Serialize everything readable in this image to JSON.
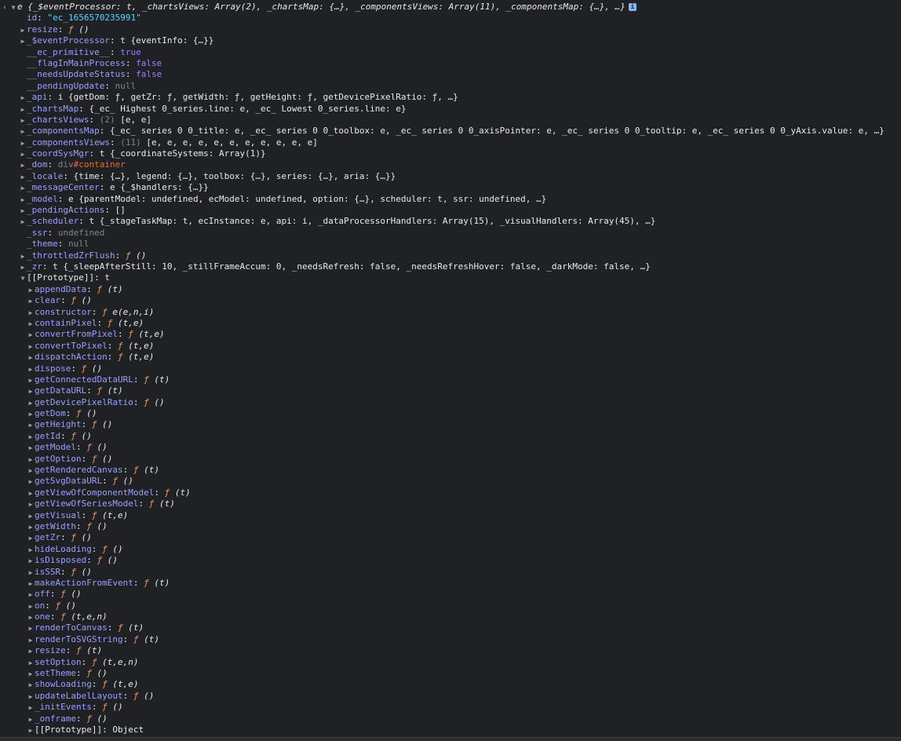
{
  "header": {
    "back_icon": "chevron-left-icon",
    "name": "e",
    "summary": "{_$eventProcessor: t, _chartsViews: Array(2), _chartsMap: {…}, _componentsViews: Array(11), _componentsMap: {…}, …}",
    "info_label": "i"
  },
  "rows": [
    {
      "indent": 1,
      "expand": false,
      "key": "id",
      "parts": [
        {
          "c": "v-str",
          "t": "\"ec_1656570235991\""
        }
      ]
    },
    {
      "indent": 1,
      "expand": true,
      "key": "resize",
      "parts": [
        {
          "c": "f-kw",
          "t": "ƒ "
        },
        {
          "c": "f-args",
          "t": "()"
        }
      ]
    },
    {
      "indent": 1,
      "expand": true,
      "key": "_$eventProcessor",
      "parts": [
        {
          "c": "v-obj",
          "t": "t {eventInfo: {…}}"
        }
      ]
    },
    {
      "indent": 1,
      "expand": false,
      "key": "__ec_primitive__",
      "parts": [
        {
          "c": "v-bool",
          "t": "true"
        }
      ]
    },
    {
      "indent": 1,
      "expand": false,
      "key": "__flagInMainProcess",
      "parts": [
        {
          "c": "v-bool",
          "t": "false"
        }
      ]
    },
    {
      "indent": 1,
      "expand": false,
      "key": "__needsUpdateStatus",
      "parts": [
        {
          "c": "v-bool",
          "t": "false"
        }
      ]
    },
    {
      "indent": 1,
      "expand": false,
      "key": "__pendingUpdate",
      "parts": [
        {
          "c": "v-null",
          "t": "null"
        }
      ]
    },
    {
      "indent": 1,
      "expand": true,
      "key": "_api",
      "parts": [
        {
          "c": "v-obj",
          "t": "i {getDom: ƒ, getZr: ƒ, getWidth: ƒ, getHeight: ƒ, getDevicePixelRatio: ƒ, …}"
        }
      ]
    },
    {
      "indent": 1,
      "expand": true,
      "key": "_chartsMap",
      "parts": [
        {
          "c": "v-obj",
          "t": "{_ec_ Highest 0_series.line: e, _ec_ Lowest 0_series.line: e}"
        }
      ]
    },
    {
      "indent": 1,
      "expand": true,
      "key": "_chartsViews",
      "parts": [
        {
          "c": "v-null",
          "t": "(2) "
        },
        {
          "c": "v-obj",
          "t": "[e, e]"
        }
      ]
    },
    {
      "indent": 1,
      "expand": true,
      "key": "_componentsMap",
      "parts": [
        {
          "c": "v-obj",
          "t": "{_ec_ series 0 0_title: e, _ec_ series 0 0_toolbox: e, _ec_ series 0 0_axisPointer: e, _ec_ series 0 0_tooltip: e, _ec_ series 0 0_yAxis.value: e, …}"
        }
      ]
    },
    {
      "indent": 1,
      "expand": true,
      "key": "_componentsViews",
      "parts": [
        {
          "c": "v-null",
          "t": "(11) "
        },
        {
          "c": "v-obj",
          "t": "[e, e, e, e, e, e, e, e, e, e, e]"
        }
      ]
    },
    {
      "indent": 1,
      "expand": true,
      "key": "_coordSysMgr",
      "parts": [
        {
          "c": "v-obj",
          "t": "t {_coordinateSystems: Array(1)}"
        }
      ]
    },
    {
      "indent": 1,
      "expand": true,
      "key": "_dom",
      "parts": [
        {
          "c": "v-null",
          "t": "div"
        },
        {
          "c": "v-tag",
          "t": "#container"
        }
      ]
    },
    {
      "indent": 1,
      "expand": true,
      "key": "_locale",
      "parts": [
        {
          "c": "v-obj",
          "t": "{time: {…}, legend: {…}, toolbox: {…}, series: {…}, aria: {…}}"
        }
      ]
    },
    {
      "indent": 1,
      "expand": true,
      "key": "_messageCenter",
      "parts": [
        {
          "c": "v-obj",
          "t": "e {_$handlers: {…}}"
        }
      ]
    },
    {
      "indent": 1,
      "expand": true,
      "key": "_model",
      "parts": [
        {
          "c": "v-obj",
          "t": "e {parentModel: undefined, ecModel: undefined, option: {…}, scheduler: t, ssr: undefined, …}"
        }
      ]
    },
    {
      "indent": 1,
      "expand": true,
      "key": "_pendingActions",
      "parts": [
        {
          "c": "v-obj",
          "t": "[]"
        }
      ]
    },
    {
      "indent": 1,
      "expand": true,
      "key": "_scheduler",
      "parts": [
        {
          "c": "v-obj",
          "t": "t {_stageTaskMap: t, ecInstance: e, api: i, _dataProcessorHandlers: Array(15), _visualHandlers: Array(45), …}"
        }
      ]
    },
    {
      "indent": 1,
      "expand": false,
      "key": "_ssr",
      "parts": [
        {
          "c": "v-null",
          "t": "undefined"
        }
      ]
    },
    {
      "indent": 1,
      "expand": false,
      "key": "_theme",
      "parts": [
        {
          "c": "v-null",
          "t": "null"
        }
      ]
    },
    {
      "indent": 1,
      "expand": true,
      "key": "_throttledZrFlush",
      "parts": [
        {
          "c": "f-kw",
          "t": "ƒ "
        },
        {
          "c": "f-args",
          "t": "()"
        }
      ]
    },
    {
      "indent": 1,
      "expand": true,
      "key": "_zr",
      "parts": [
        {
          "c": "v-obj",
          "t": "t {_sleepAfterStill: 10, _stillFrameAccum: 0, _needsRefresh: false, _needsRefreshHover: false, _darkMode: false, …}"
        }
      ]
    },
    {
      "indent": 1,
      "expand": "open",
      "key": "[[Prototype]]",
      "plainkey": true,
      "parts": [
        {
          "c": "v-obj",
          "t": "t"
        }
      ]
    },
    {
      "indent": 2,
      "expand": true,
      "key": "appendData",
      "parts": [
        {
          "c": "f-kw",
          "t": "ƒ "
        },
        {
          "c": "f-args",
          "t": "(t)"
        }
      ]
    },
    {
      "indent": 2,
      "expand": true,
      "key": "clear",
      "parts": [
        {
          "c": "f-kw",
          "t": "ƒ "
        },
        {
          "c": "f-args",
          "t": "()"
        }
      ]
    },
    {
      "indent": 2,
      "expand": true,
      "key": "constructor",
      "parts": [
        {
          "c": "f-kw",
          "t": "ƒ "
        },
        {
          "c": "f-args",
          "t": "e(e,n,i)"
        }
      ]
    },
    {
      "indent": 2,
      "expand": true,
      "key": "containPixel",
      "parts": [
        {
          "c": "f-kw",
          "t": "ƒ "
        },
        {
          "c": "f-args",
          "t": "(t,e)"
        }
      ]
    },
    {
      "indent": 2,
      "expand": true,
      "key": "convertFromPixel",
      "parts": [
        {
          "c": "f-kw",
          "t": "ƒ "
        },
        {
          "c": "f-args",
          "t": "(t,e)"
        }
      ]
    },
    {
      "indent": 2,
      "expand": true,
      "key": "convertToPixel",
      "parts": [
        {
          "c": "f-kw",
          "t": "ƒ "
        },
        {
          "c": "f-args",
          "t": "(t,e)"
        }
      ]
    },
    {
      "indent": 2,
      "expand": true,
      "key": "dispatchAction",
      "parts": [
        {
          "c": "f-kw",
          "t": "ƒ "
        },
        {
          "c": "f-args",
          "t": "(t,e)"
        }
      ]
    },
    {
      "indent": 2,
      "expand": true,
      "key": "dispose",
      "parts": [
        {
          "c": "f-kw",
          "t": "ƒ "
        },
        {
          "c": "f-args",
          "t": "()"
        }
      ]
    },
    {
      "indent": 2,
      "expand": true,
      "key": "getConnectedDataURL",
      "parts": [
        {
          "c": "f-kw",
          "t": "ƒ "
        },
        {
          "c": "f-args",
          "t": "(t)"
        }
      ]
    },
    {
      "indent": 2,
      "expand": true,
      "key": "getDataURL",
      "parts": [
        {
          "c": "f-kw",
          "t": "ƒ "
        },
        {
          "c": "f-args",
          "t": "(t)"
        }
      ]
    },
    {
      "indent": 2,
      "expand": true,
      "key": "getDevicePixelRatio",
      "parts": [
        {
          "c": "f-kw",
          "t": "ƒ "
        },
        {
          "c": "f-args",
          "t": "()"
        }
      ]
    },
    {
      "indent": 2,
      "expand": true,
      "key": "getDom",
      "parts": [
        {
          "c": "f-kw",
          "t": "ƒ "
        },
        {
          "c": "f-args",
          "t": "()"
        }
      ]
    },
    {
      "indent": 2,
      "expand": true,
      "key": "getHeight",
      "parts": [
        {
          "c": "f-kw",
          "t": "ƒ "
        },
        {
          "c": "f-args",
          "t": "()"
        }
      ]
    },
    {
      "indent": 2,
      "expand": true,
      "key": "getId",
      "parts": [
        {
          "c": "f-kw",
          "t": "ƒ "
        },
        {
          "c": "f-args",
          "t": "()"
        }
      ]
    },
    {
      "indent": 2,
      "expand": true,
      "key": "getModel",
      "parts": [
        {
          "c": "f-kw",
          "t": "ƒ "
        },
        {
          "c": "f-args",
          "t": "()"
        }
      ]
    },
    {
      "indent": 2,
      "expand": true,
      "key": "getOption",
      "parts": [
        {
          "c": "f-kw",
          "t": "ƒ "
        },
        {
          "c": "f-args",
          "t": "()"
        }
      ]
    },
    {
      "indent": 2,
      "expand": true,
      "key": "getRenderedCanvas",
      "parts": [
        {
          "c": "f-kw",
          "t": "ƒ "
        },
        {
          "c": "f-args",
          "t": "(t)"
        }
      ]
    },
    {
      "indent": 2,
      "expand": true,
      "key": "getSvgDataURL",
      "parts": [
        {
          "c": "f-kw",
          "t": "ƒ "
        },
        {
          "c": "f-args",
          "t": "()"
        }
      ]
    },
    {
      "indent": 2,
      "expand": true,
      "key": "getViewOfComponentModel",
      "parts": [
        {
          "c": "f-kw",
          "t": "ƒ "
        },
        {
          "c": "f-args",
          "t": "(t)"
        }
      ]
    },
    {
      "indent": 2,
      "expand": true,
      "key": "getViewOfSeriesModel",
      "parts": [
        {
          "c": "f-kw",
          "t": "ƒ "
        },
        {
          "c": "f-args",
          "t": "(t)"
        }
      ]
    },
    {
      "indent": 2,
      "expand": true,
      "key": "getVisual",
      "parts": [
        {
          "c": "f-kw",
          "t": "ƒ "
        },
        {
          "c": "f-args",
          "t": "(t,e)"
        }
      ]
    },
    {
      "indent": 2,
      "expand": true,
      "key": "getWidth",
      "parts": [
        {
          "c": "f-kw",
          "t": "ƒ "
        },
        {
          "c": "f-args",
          "t": "()"
        }
      ]
    },
    {
      "indent": 2,
      "expand": true,
      "key": "getZr",
      "parts": [
        {
          "c": "f-kw",
          "t": "ƒ "
        },
        {
          "c": "f-args",
          "t": "()"
        }
      ]
    },
    {
      "indent": 2,
      "expand": true,
      "key": "hideLoading",
      "parts": [
        {
          "c": "f-kw",
          "t": "ƒ "
        },
        {
          "c": "f-args",
          "t": "()"
        }
      ]
    },
    {
      "indent": 2,
      "expand": true,
      "key": "isDisposed",
      "parts": [
        {
          "c": "f-kw",
          "t": "ƒ "
        },
        {
          "c": "f-args",
          "t": "()"
        }
      ]
    },
    {
      "indent": 2,
      "expand": true,
      "key": "isSSR",
      "parts": [
        {
          "c": "f-kw",
          "t": "ƒ "
        },
        {
          "c": "f-args",
          "t": "()"
        }
      ]
    },
    {
      "indent": 2,
      "expand": true,
      "key": "makeActionFromEvent",
      "parts": [
        {
          "c": "f-kw",
          "t": "ƒ "
        },
        {
          "c": "f-args",
          "t": "(t)"
        }
      ]
    },
    {
      "indent": 2,
      "expand": true,
      "key": "off",
      "parts": [
        {
          "c": "f-kw",
          "t": "ƒ "
        },
        {
          "c": "f-args",
          "t": "()"
        }
      ]
    },
    {
      "indent": 2,
      "expand": true,
      "key": "on",
      "parts": [
        {
          "c": "f-kw",
          "t": "ƒ "
        },
        {
          "c": "f-args",
          "t": "()"
        }
      ]
    },
    {
      "indent": 2,
      "expand": true,
      "key": "one",
      "parts": [
        {
          "c": "f-kw",
          "t": "ƒ "
        },
        {
          "c": "f-args",
          "t": "(t,e,n)"
        }
      ]
    },
    {
      "indent": 2,
      "expand": true,
      "key": "renderToCanvas",
      "parts": [
        {
          "c": "f-kw",
          "t": "ƒ "
        },
        {
          "c": "f-args",
          "t": "(t)"
        }
      ]
    },
    {
      "indent": 2,
      "expand": true,
      "key": "renderToSVGString",
      "parts": [
        {
          "c": "f-kw",
          "t": "ƒ "
        },
        {
          "c": "f-args",
          "t": "(t)"
        }
      ]
    },
    {
      "indent": 2,
      "expand": true,
      "key": "resize",
      "parts": [
        {
          "c": "f-kw",
          "t": "ƒ "
        },
        {
          "c": "f-args",
          "t": "(t)"
        }
      ]
    },
    {
      "indent": 2,
      "expand": true,
      "key": "setOption",
      "parts": [
        {
          "c": "f-kw",
          "t": "ƒ "
        },
        {
          "c": "f-args",
          "t": "(t,e,n)"
        }
      ]
    },
    {
      "indent": 2,
      "expand": true,
      "key": "setTheme",
      "parts": [
        {
          "c": "f-kw",
          "t": "ƒ "
        },
        {
          "c": "f-args",
          "t": "()"
        }
      ]
    },
    {
      "indent": 2,
      "expand": true,
      "key": "showLoading",
      "parts": [
        {
          "c": "f-kw",
          "t": "ƒ "
        },
        {
          "c": "f-args",
          "t": "(t,e)"
        }
      ]
    },
    {
      "indent": 2,
      "expand": true,
      "key": "updateLabelLayout",
      "parts": [
        {
          "c": "f-kw",
          "t": "ƒ "
        },
        {
          "c": "f-args",
          "t": "()"
        }
      ]
    },
    {
      "indent": 2,
      "expand": true,
      "key": "_initEvents",
      "parts": [
        {
          "c": "f-kw",
          "t": "ƒ "
        },
        {
          "c": "f-args",
          "t": "()"
        }
      ]
    },
    {
      "indent": 2,
      "expand": true,
      "key": "_onframe",
      "parts": [
        {
          "c": "f-kw",
          "t": "ƒ "
        },
        {
          "c": "f-args",
          "t": "()"
        }
      ]
    },
    {
      "indent": 2,
      "expand": true,
      "key": "[[Prototype]]",
      "plainkey": true,
      "parts": [
        {
          "c": "v-obj",
          "t": "Object"
        }
      ]
    }
  ]
}
